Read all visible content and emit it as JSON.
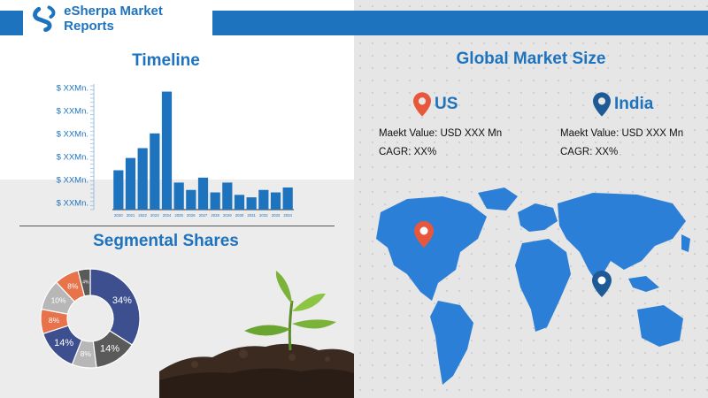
{
  "header": {
    "brand": "eSherpa Market Reports"
  },
  "timeline": {
    "title": "Timeline"
  },
  "segmental": {
    "title": "Segmental Shares"
  },
  "global": {
    "title": "Global Market Size",
    "us": {
      "name": "US",
      "market_value": "Maekt Value: USD XXX Mn",
      "cagr": "CAGR: XX%"
    },
    "india": {
      "name": "India",
      "market_value": "Maekt Value: USD XXX Mn",
      "cagr": "CAGR: XX%"
    }
  },
  "colors": {
    "brand_blue": "#1e73be",
    "pin_red": "#e8573c",
    "pin_blue": "#1e5a96",
    "map_blue": "#2c7fd6"
  },
  "chart_data": [
    {
      "type": "bar",
      "title": "Timeline",
      "categories": [
        "2020",
        "2021",
        "2022",
        "2023",
        "2024",
        "2025",
        "2026",
        "2027",
        "2028",
        "2029",
        "2030",
        "2031",
        "2032",
        "2033",
        "2034"
      ],
      "values": [
        16,
        21,
        25,
        31,
        48,
        11,
        8,
        13,
        7,
        11,
        6,
        5,
        8,
        7,
        9
      ],
      "y_tick_labels": [
        "$ XXMn.",
        "$ XXMn.",
        "$ XXMn.",
        "$ XXMn.",
        "$ XXMn.",
        "$ XXMn."
      ],
      "ylim": [
        0,
        50
      ],
      "color": "#1e73be"
    },
    {
      "type": "pie",
      "title": "Segmental Shares",
      "slices": [
        {
          "label": "34%",
          "value": 34,
          "color": "#3d4f8f"
        },
        {
          "label": "14%",
          "value": 14,
          "color": "#5a5a5a"
        },
        {
          "label": "8%",
          "value": 8,
          "color": "#b7b7b7"
        },
        {
          "label": "14%",
          "value": 14,
          "color": "#3d4f8f"
        },
        {
          "label": "8%",
          "value": 8,
          "color": "#e8734a"
        },
        {
          "label": "10%",
          "value": 10,
          "color": "#b7b7b7"
        },
        {
          "label": "8%",
          "value": 8,
          "color": "#e8734a"
        },
        {
          "label": "4%",
          "value": 4,
          "color": "#5a5a5a"
        }
      ]
    }
  ]
}
